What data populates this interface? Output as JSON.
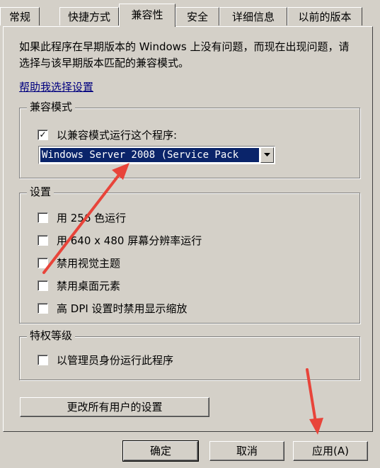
{
  "tabs": [
    {
      "label": "常规"
    },
    {
      "label": "快捷方式"
    },
    {
      "label": "兼容性"
    },
    {
      "label": "安全"
    },
    {
      "label": "详细信息"
    },
    {
      "label": "以前的版本"
    }
  ],
  "description": "如果此程序在早期版本的 Windows 上没有问题，而现在出现问题，请选择与该早期版本匹配的兼容模式。",
  "help_link": "帮助我选择设置",
  "compat_group": {
    "title": "兼容模式",
    "checkbox_label": "以兼容模式运行这个程序:",
    "checkbox_checked": true,
    "select_value": "Windows Server 2008 (Service Pack"
  },
  "settings_group": {
    "title": "设置",
    "options": [
      {
        "label": "用 256 色运行",
        "checked": false
      },
      {
        "label": "用 640 x 480 屏幕分辨率运行",
        "checked": false
      },
      {
        "label": "禁用视觉主题",
        "checked": false
      },
      {
        "label": "禁用桌面元素",
        "checked": false
      },
      {
        "label": "高 DPI 设置时禁用显示缩放",
        "checked": false
      }
    ]
  },
  "privilege_group": {
    "title": "特权等级",
    "option_label": "以管理员身份运行此程序",
    "option_checked": false
  },
  "change_all_users_button": "更改所有用户的设置",
  "footer": {
    "ok": "确定",
    "cancel": "取消",
    "apply": "应用(A)"
  },
  "colors": {
    "window": "#d4d0c8",
    "selection": "#0a246a",
    "link": "#00007f",
    "annotation_arrow": "#e8443a"
  }
}
